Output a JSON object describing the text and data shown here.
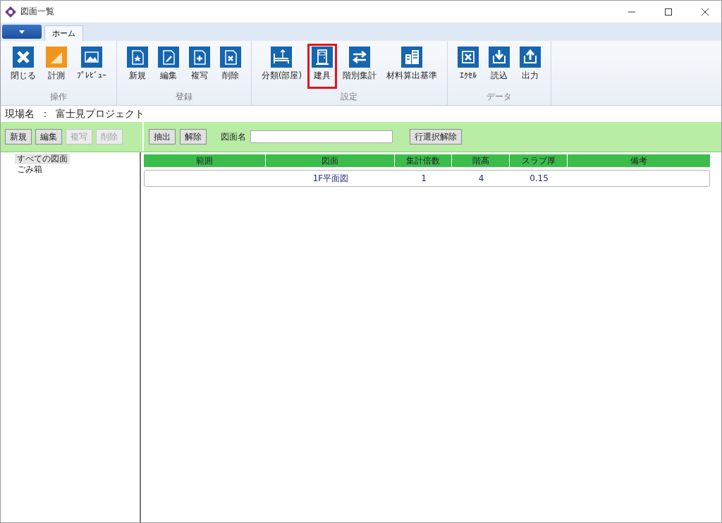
{
  "window": {
    "title": "図面一覧"
  },
  "tabs": [
    {
      "label": "ホーム",
      "selected": true
    }
  ],
  "ribbon": [
    {
      "label": "操作",
      "buttons": [
        {
          "label": "閉じる",
          "kind": "close",
          "color": "#1565b0",
          "highlighted": false
        },
        {
          "label": "計測",
          "kind": "ruler",
          "color": "#f0961e",
          "highlighted": false
        },
        {
          "label": "ﾌﾟﾚﾋﾞｭｰ",
          "kind": "image",
          "color": "#1565b0",
          "highlighted": false
        }
      ]
    },
    {
      "label": "登録",
      "buttons": [
        {
          "label": "新規",
          "kind": "new",
          "color": "#1565b0",
          "highlighted": false
        },
        {
          "label": "編集",
          "kind": "edit",
          "color": "#1565b0",
          "highlighted": false
        },
        {
          "label": "複写",
          "kind": "copy",
          "color": "#1565b0",
          "highlighted": false
        },
        {
          "label": "削除",
          "kind": "delete",
          "color": "#1565b0",
          "highlighted": false
        }
      ]
    },
    {
      "label": "設定",
      "buttons": [
        {
          "label": "分類(部屋)",
          "kind": "room",
          "color": "#1565b0",
          "highlighted": false
        },
        {
          "label": "建具",
          "kind": "door",
          "color": "#1565b0",
          "highlighted": true
        },
        {
          "label": "階別集計",
          "kind": "swap",
          "color": "#1565b0",
          "highlighted": false
        },
        {
          "label": "材料算出基準",
          "kind": "building",
          "color": "#1565b0",
          "highlighted": false
        }
      ]
    },
    {
      "label": "データ",
      "buttons": [
        {
          "label": "ｴｸｾﾙ",
          "kind": "sheet",
          "color": "#1565b0",
          "highlighted": false
        },
        {
          "label": "読込",
          "kind": "import",
          "color": "#1565b0",
          "highlighted": false
        },
        {
          "label": "出力",
          "kind": "export",
          "color": "#1565b0",
          "highlighted": false
        }
      ]
    }
  ],
  "project": {
    "label": "現場名",
    "separator": "：",
    "name": "富士見プロジェクト"
  },
  "left_buttons": [
    {
      "label": "新規",
      "disabled": false
    },
    {
      "label": "編集",
      "disabled": false
    },
    {
      "label": "複写",
      "disabled": true
    },
    {
      "label": "削除",
      "disabled": true
    }
  ],
  "filter": {
    "buttons": [
      {
        "label": "抽出"
      },
      {
        "label": "解除"
      }
    ],
    "field_label": "図面名",
    "clear_button": "行選択解除"
  },
  "tree": [
    {
      "label": "すべての図面",
      "selected": true
    },
    {
      "label": "ごみ箱",
      "selected": false
    }
  ],
  "table": {
    "columns": [
      "範囲",
      "図面",
      "集計倍数",
      "階高",
      "スラブ厚",
      "備考"
    ],
    "rows": [
      [
        "",
        "1F平面図",
        "1",
        "4",
        "0.15",
        ""
      ]
    ]
  }
}
